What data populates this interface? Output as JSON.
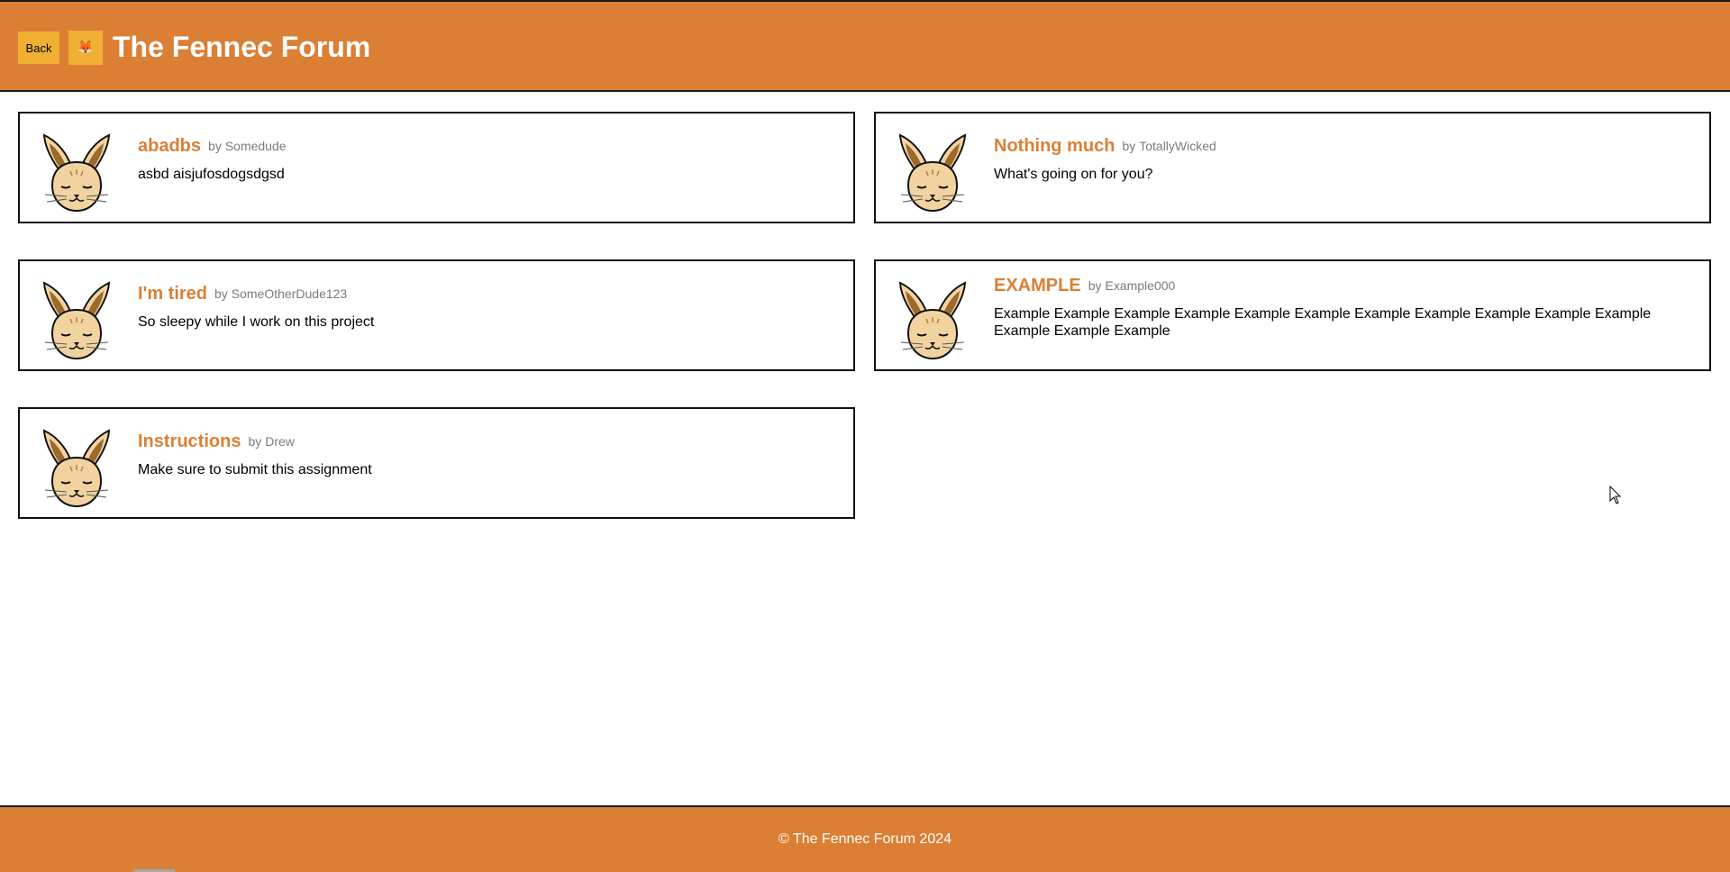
{
  "header": {
    "back_label": "Back",
    "logo_icon": "fox-emoji-icon",
    "logo_glyph": "🦊",
    "title": "The Fennec Forum"
  },
  "posts": [
    {
      "title": "abadbs",
      "by_label": "by",
      "author": "Somedude",
      "body": "asbd aisjufosdogsdgsd",
      "avatar_icon": "fennec-fox-avatar-icon"
    },
    {
      "title": "Nothing much",
      "by_label": "by",
      "author": "TotallyWicked",
      "body": "What's going on for you?",
      "avatar_icon": "fennec-fox-avatar-icon"
    },
    {
      "title": "I'm tired",
      "by_label": "by",
      "author": "SomeOtherDude123",
      "body": "So sleepy while I work on this project",
      "avatar_icon": "fennec-fox-avatar-icon"
    },
    {
      "title": "EXAMPLE",
      "by_label": "by",
      "author": "Example000",
      "body": "Example Example Example Example Example Example Example Example Example Example Example Example Example Example",
      "avatar_icon": "fennec-fox-avatar-icon"
    },
    {
      "title": "Instructions",
      "by_label": "by",
      "author": "Drew",
      "body": "Make sure to submit this assignment",
      "avatar_icon": "fennec-fox-avatar-icon"
    }
  ],
  "footer": {
    "text": "© The Fennec Forum 2024"
  },
  "colors": {
    "brand_orange": "#db7f35",
    "button_yellow": "#f0b034",
    "author_gray": "#7b7b7b"
  }
}
